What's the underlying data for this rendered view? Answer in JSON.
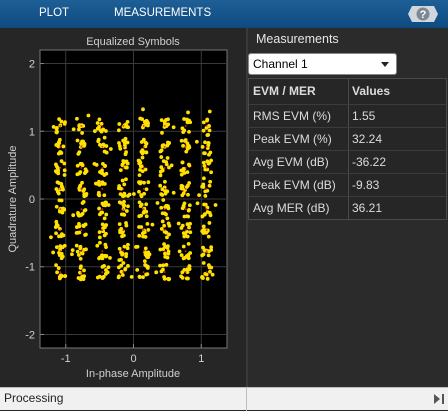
{
  "toolstrip": {
    "tabs": [
      "PLOT",
      "MEASUREMENTS"
    ],
    "help_label": "?"
  },
  "plot": {
    "title": "Equalized Symbols",
    "xlabel": "In-phase Amplitude",
    "ylabel": "Quadrature Amplitude",
    "xticks": [
      "-1",
      "0",
      "1"
    ],
    "yticks": [
      "2",
      "1",
      "0",
      "-1",
      "-2"
    ]
  },
  "measurements": {
    "title": "Measurements",
    "channel": "Channel 1",
    "headers": [
      "EVM / MER",
      "Values"
    ],
    "rows": [
      {
        "label": "RMS EVM (%)",
        "value": "1.55"
      },
      {
        "label": "Peak EVM (%)",
        "value": "32.24"
      },
      {
        "label": "Avg EVM (dB)",
        "value": "-36.22"
      },
      {
        "label": "Peak EVM (dB)",
        "value": "-9.83"
      },
      {
        "label": "Avg MER (dB)",
        "value": "36.21"
      }
    ]
  },
  "status": {
    "text": "Processing"
  },
  "colors": {
    "accent": "#0e4a80",
    "symbol": "#ffe000",
    "symbol_ref": "#e8262b",
    "axes_bg": "#000000"
  },
  "chart_data": {
    "type": "scatter",
    "title": "Equalized Symbols",
    "xlabel": "In-phase Amplitude",
    "ylabel": "Quadrature Amplitude",
    "xlim": [
      -1.38,
      1.38
    ],
    "ylim": [
      -2.2,
      2.2
    ],
    "xticks": [
      -1,
      0,
      1
    ],
    "yticks": [
      -2,
      -1,
      0,
      1,
      2
    ],
    "grid": true,
    "constellation_levels": [
      -1.08,
      -0.77,
      -0.46,
      -0.15,
      0.15,
      0.46,
      0.77,
      1.08
    ],
    "series": [
      {
        "name": "",
        "values": "64-QAM equalized symbol clusters (8x8 grid)"
      }
    ]
  }
}
